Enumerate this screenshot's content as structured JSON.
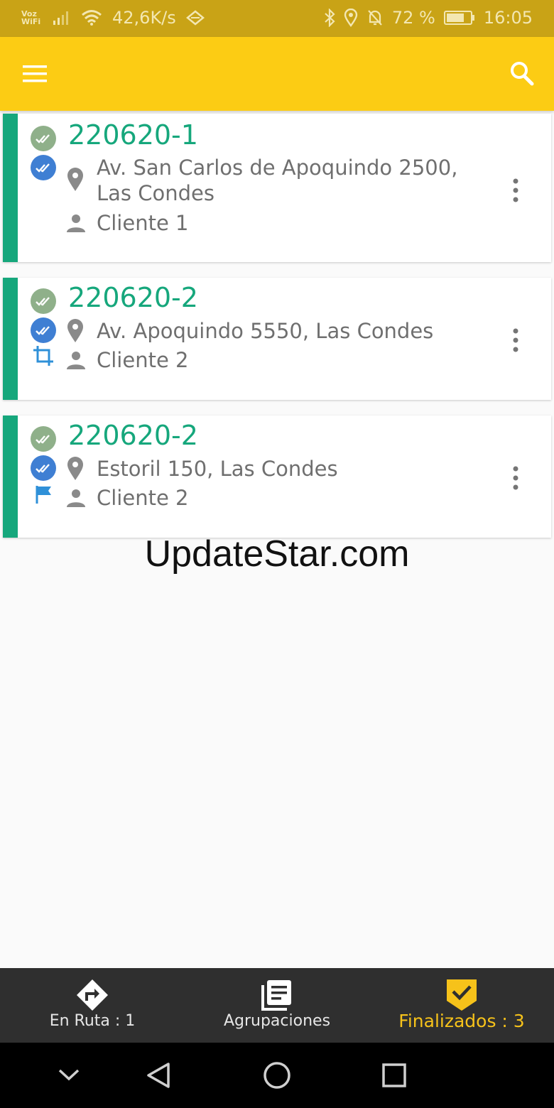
{
  "status_bar": {
    "voz_line1": "Voz",
    "voz_line2": "WiFi",
    "network_speed": "42,6K/s",
    "battery": "72 %",
    "time": "16:05"
  },
  "app_bar": {
    "menu_icon": "hamburger-menu-icon",
    "search_icon": "search-icon"
  },
  "orders": [
    {
      "code": "220620-1",
      "address_line1": "Av.  San Carlos de Apoquindo 2500,",
      "address_line2": "Las Condes",
      "client": "Cliente 1",
      "extra_icon": ""
    },
    {
      "code": "220620-2",
      "address_line1": "Av. Apoquindo 5550, Las Condes",
      "client": "Cliente 2",
      "extra_icon": "crop-icon"
    },
    {
      "code": "220620-2",
      "address_line1": "Estoril 150, Las Condes",
      "client": "Cliente 2",
      "extra_icon": "flag-icon"
    }
  ],
  "watermark": "UpdateStar.com",
  "bottom_nav": {
    "tabs": [
      {
        "label": "En Ruta : 1",
        "icon": "route-turn-icon"
      },
      {
        "label": "Agrupaciones",
        "icon": "list-icon"
      },
      {
        "label": "Finalizados : 3",
        "icon": "finished-check-icon",
        "active": true
      }
    ]
  },
  "colors": {
    "status_bar": "#c9a316",
    "app_bar": "#fccc14",
    "accent_green": "#16a77c",
    "check_grey": "#8fb08a",
    "check_blue": "#3f7fd3",
    "active_tab": "#f6c21a",
    "bottom_nav": "#2f2f2f"
  }
}
